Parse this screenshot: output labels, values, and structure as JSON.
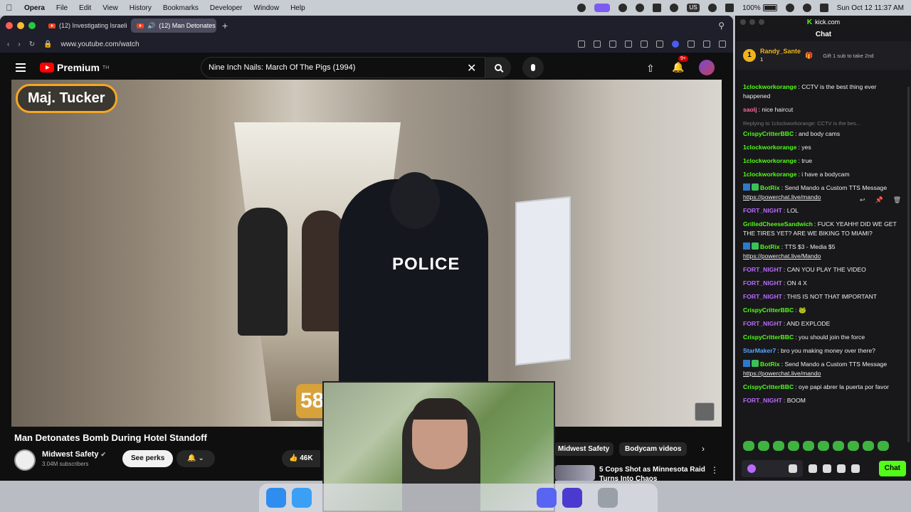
{
  "menubar": {
    "app": "Opera",
    "items": [
      "File",
      "Edit",
      "View",
      "History",
      "Bookmarks",
      "Developer",
      "Window",
      "Help"
    ],
    "input_source": "US",
    "battery": "100%",
    "datetime": "Sun Oct 12  11:37 AM"
  },
  "browser": {
    "tabs": [
      {
        "label": "(12) Investigating Israeli"
      },
      {
        "label": "(12) Man Detonates"
      }
    ],
    "url": "www.youtube.com/watch"
  },
  "youtube": {
    "logo": "Premium",
    "logo_region": "TH",
    "search_value": "Nine Inch Nails: March Of The Pigs (1994)",
    "notif_count": "9+",
    "video": {
      "name_overlay": "Maj. Tucker",
      "vest_text": "POLICE",
      "timer_digits": "58"
    },
    "title": "Man Detonates Bomb During Hotel Standoff",
    "channel": "Midwest Safety",
    "subscribers": "3.04M subscribers",
    "perks_label": "See perks",
    "likes": "46K",
    "chips": [
      "Midwest Safety",
      "Bodycam videos"
    ],
    "recommended_title": "5 Cops Shot as Minnesota Raid Turns Into Chaos"
  },
  "chat": {
    "site": "kick.com",
    "title": "Chat",
    "pinned": {
      "user": "Randy_Sante",
      "count": "1",
      "message": "Gift 1 sub to take 2nd"
    },
    "messages": [
      {
        "user": "1clockworkorange",
        "color": "green",
        "text": "CCTV is the best thing ever happened"
      },
      {
        "user": "saolj",
        "color": "pink",
        "text": "nice haircut"
      },
      {
        "reply": "Replying to 1clockworkorange: CCTV is the bes...",
        "user": "CrispyCritterBBC",
        "color": "green",
        "text": "and body cams"
      },
      {
        "user": "1clockworkorange",
        "color": "green",
        "text": "yes"
      },
      {
        "user": "1clockworkorange",
        "color": "green",
        "text": "true"
      },
      {
        "user": "1clockworkorange",
        "color": "green",
        "text": "i have a bodycam"
      },
      {
        "user": "BotRix",
        "color": "green",
        "bot": true,
        "text": "Send Mando a Custom TTS Message ",
        "link": "https://powerchat.live/mando"
      },
      {
        "user": "FORT_NIGHT",
        "color": "purple",
        "text": "LOL"
      },
      {
        "user": "GrilledCheeseSandwich",
        "color": "green",
        "text": "FUCK YEAHH! DID WE GET THE TIRES YET? ARE WE BIKING TO MIAMI?"
      },
      {
        "user": "BotRix",
        "color": "green",
        "bot": true,
        "text": "TTS $3 - Media $5 ",
        "link": "https://powerchat.live/Mando"
      },
      {
        "user": "FORT_NIGHT",
        "color": "purple",
        "text": "CAN YOU PLAY THE VIDEO"
      },
      {
        "user": "FORT_NIGHT",
        "color": "purple",
        "text": "ON 4 X"
      },
      {
        "user": "FORT_NIGHT",
        "color": "purple",
        "text": "THIS IS NOT THAT IMPORTANT"
      },
      {
        "user": "CrispyCritterBBC",
        "color": "green",
        "text": "🐸"
      },
      {
        "user": "FORT_NIGHT",
        "color": "purple",
        "text": "AND EXPLODE"
      },
      {
        "user": "CrispyCritterBBC",
        "color": "green",
        "text": "you should join the force"
      },
      {
        "user": "StarMaker7",
        "color": "blue",
        "text": "bro you making money over there?"
      },
      {
        "user": "BotRix",
        "color": "green",
        "bot": true,
        "text": "Send Mando a Custom TTS Message ",
        "link": "https://powerchat.live/mando"
      },
      {
        "user": "CrispyCritterBBC",
        "color": "green",
        "text": "oye papi abrer la puerta por favor"
      },
      {
        "user": "FORT_NIGHT",
        "color": "purple",
        "text": "BOOM"
      }
    ],
    "send_label": "Chat"
  },
  "colors": {
    "kick_green": "#53fc18",
    "yt_red": "#ff0000",
    "fort_purple": "#b96bfc"
  }
}
